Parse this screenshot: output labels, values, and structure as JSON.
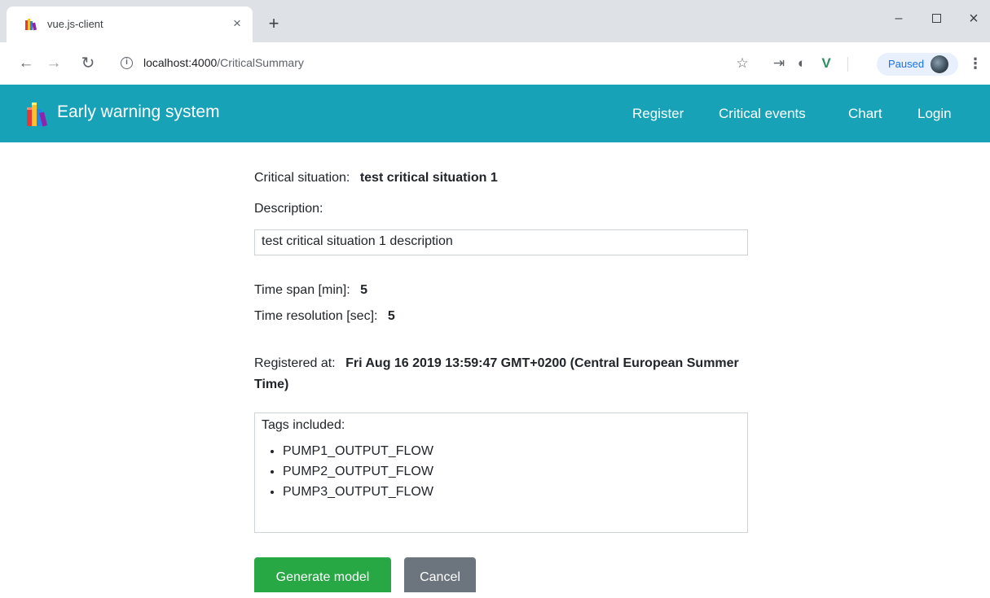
{
  "browser": {
    "tab_title": "vue.js-client",
    "tab_close": "×",
    "new_tab": "+",
    "url_host": "localhost:4000",
    "url_path": "/CriticalSummary",
    "paused_label": "Paused",
    "window": {
      "minimize": "–",
      "maximize": "",
      "close": "×"
    }
  },
  "navbar": {
    "brand": "Early warning system",
    "links": [
      "Register",
      "Critical events",
      "Chart",
      "Login"
    ],
    "color": "#17a2b8"
  },
  "summary": {
    "situation_label": "Critical situation:",
    "situation_value": "test critical situation 1",
    "description_label": "Description:",
    "description_value": "test critical situation 1 description",
    "timespan_label": "Time span [min]:",
    "timespan_value": "5",
    "resolution_label": "Time resolution [sec]:",
    "resolution_value": "5",
    "registered_label": "Registered at:",
    "registered_value": "Fri Aug 16 2019 13:59:47 GMT+0200 (Central European Summer Time)",
    "tags_label": "Tags included:",
    "tags": [
      "PUMP1_OUTPUT_FLOW",
      "PUMP2_OUTPUT_FLOW",
      "PUMP3_OUTPUT_FLOW"
    ]
  },
  "actions": {
    "generate_label": "Generate model",
    "generate_color": "#28a745",
    "cancel_label": "Cancel",
    "cancel_color": "#6c757d"
  }
}
